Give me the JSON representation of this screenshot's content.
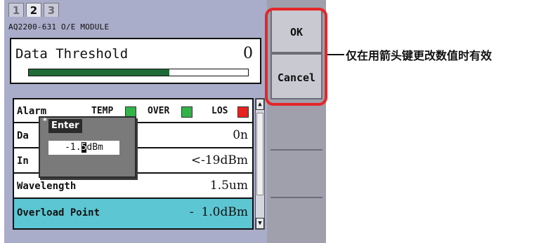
{
  "tabs": [
    {
      "label": "1",
      "active": false
    },
    {
      "label": "2",
      "active": true
    },
    {
      "label": "3",
      "active": false
    }
  ],
  "module_name": "AQ2200-631 O/E MODULE",
  "threshold": {
    "label": "Data Threshold",
    "value": "0",
    "level_fraction": 0.64
  },
  "alarm": {
    "label": "Alarm",
    "indicators": [
      {
        "label": "TEMP",
        "color": "#33b24a"
      },
      {
        "label": "OVER",
        "color": "#33b24a"
      },
      {
        "label": "LOS",
        "color": "#e8221f"
      }
    ]
  },
  "rows": [
    {
      "label": "Da",
      "value": "0n"
    },
    {
      "label": "In",
      "value": "<-19dBm"
    },
    {
      "label": "Wavelength",
      "value": "1.5um"
    }
  ],
  "selected_row": {
    "label": "Overload Point",
    "value": "-  1.0dBm"
  },
  "enter_dialog": {
    "title": "Enter",
    "value_before": "-1.",
    "value_cursor": "5",
    "value_after": "dBm"
  },
  "softkeys": {
    "ok": "OK",
    "cancel": "Cancel"
  },
  "annotation": "仅在用箭头键更改数值时有效",
  "colors": {
    "screen_bg": "#a9adc9",
    "selected_row": "#5cc6d3",
    "level_bar": "#1f6b38",
    "callout": "#e52629"
  }
}
